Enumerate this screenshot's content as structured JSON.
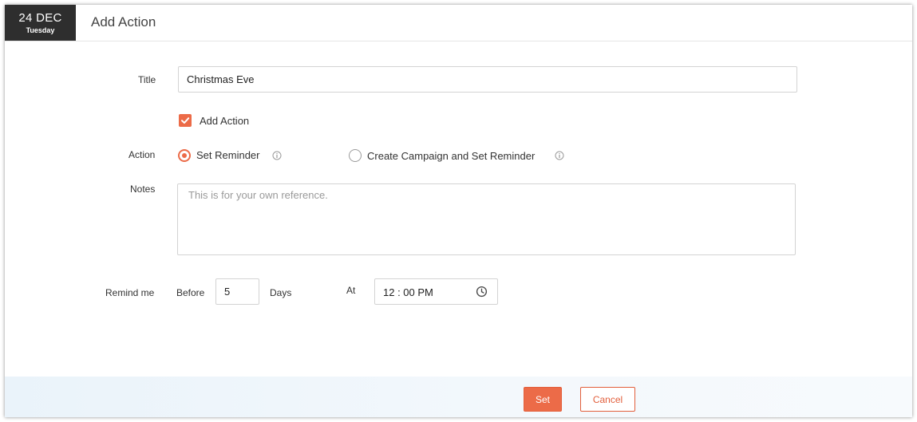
{
  "header": {
    "date_main": "24 DEC",
    "date_sub": "Tuesday",
    "title": "Add Action"
  },
  "form": {
    "title_label": "Title",
    "title_value": "Christmas Eve",
    "add_action_label": "Add Action",
    "add_action_checked": true,
    "action_label": "Action",
    "action_options": [
      {
        "label": "Set Reminder",
        "selected": true
      },
      {
        "label": "Create Campaign and Set Reminder",
        "selected": false
      }
    ],
    "notes_label": "Notes",
    "notes_placeholder": "This is for your own reference.",
    "remind_label": "Remind me",
    "before_label": "Before",
    "before_value": "5",
    "days_label": "Days",
    "at_label": "At",
    "time_value": "12 : 00 PM"
  },
  "footer": {
    "set_label": "Set",
    "cancel_label": "Cancel"
  },
  "colors": {
    "accent": "#ec6b48",
    "date_badge_bg": "#2e2e2e"
  }
}
